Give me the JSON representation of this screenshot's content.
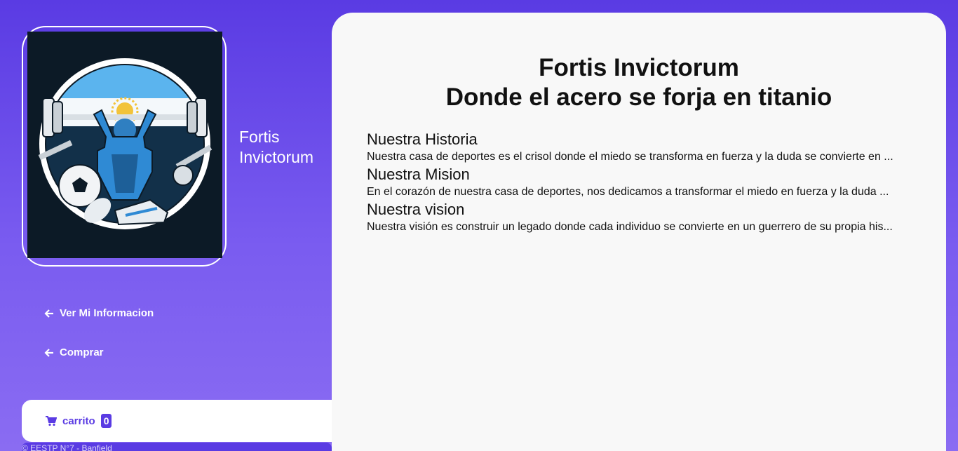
{
  "brand": {
    "name": "Fortis Invictorum",
    "logo_icon": "gym-logo-icon"
  },
  "nav": [
    {
      "label": "Ver Mi Informacion",
      "icon": "arrow-left-icon"
    },
    {
      "label": "Comprar",
      "icon": "arrow-left-icon"
    }
  ],
  "cart": {
    "label": "carrito",
    "count": "0",
    "icon": "cart-icon"
  },
  "footer": {
    "text": "© EESTP N°7 - Banfield"
  },
  "main": {
    "title_line1": "Fortis Invictorum",
    "title_line2": "Donde el acero se forja en titanio",
    "sections": [
      {
        "title": "Nuestra Historia",
        "text": "Nuestra casa de deportes es el crisol donde el miedo se transforma en fuerza y la duda se convierte en ..."
      },
      {
        "title": "Nuestra Mision",
        "text": "En el corazón de nuestra casa de deportes, nos dedicamos a transformar el miedo en fuerza y la duda ..."
      },
      {
        "title": "Nuestra vision",
        "text": "Nuestra visión es construir un legado donde cada individuo se convierte en un guerrero de su propia his..."
      }
    ]
  },
  "colors": {
    "accent": "#5a3be3",
    "panel": "#f8f8f8"
  }
}
